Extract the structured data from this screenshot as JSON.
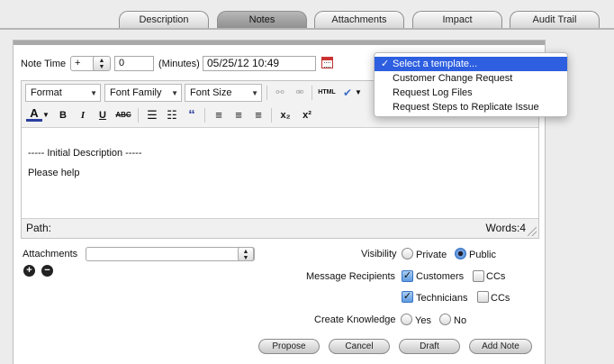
{
  "tabs": [
    {
      "label": "Description",
      "active": false
    },
    {
      "label": "Notes",
      "active": true
    },
    {
      "label": "Attachments",
      "active": false
    },
    {
      "label": "Impact",
      "active": false
    },
    {
      "label": "Audit Trail",
      "active": false
    }
  ],
  "note_time": {
    "label": "Note Time",
    "sign": "+",
    "value": "0",
    "unit_label": "(Minutes)",
    "datetime": "05/25/12 10:49"
  },
  "editor": {
    "format_select": "Format",
    "font_family_select": "Font Family",
    "font_size_select": "Font Size",
    "html_label": "HTML",
    "content_line1": "----- Initial Description -----",
    "content_line2": "Please help",
    "path_label": "Path:",
    "words_label": "Words:4"
  },
  "template_menu": {
    "items": [
      {
        "label": "Select a template...",
        "selected": true,
        "tick": "✓"
      },
      {
        "label": "Customer Change Request",
        "selected": false
      },
      {
        "label": "Request Log Files",
        "selected": false
      },
      {
        "label": "Request Steps to Replicate Issue",
        "selected": false
      }
    ]
  },
  "attachments": {
    "label": "Attachments",
    "value": ""
  },
  "visibility": {
    "label": "Visibility",
    "private": "Private",
    "public": "Public",
    "selected": "Public"
  },
  "recipients": {
    "label": "Message Recipients",
    "customers": "Customers",
    "customers_checked": true,
    "customers_ccs": "CCs",
    "customers_ccs_checked": false,
    "technicians": "Technicians",
    "technicians_checked": true,
    "technicians_ccs": "CCs",
    "technicians_ccs_checked": false
  },
  "knowledge": {
    "label": "Create Knowledge",
    "yes": "Yes",
    "no": "No"
  },
  "buttons": {
    "propose": "Propose",
    "cancel": "Cancel",
    "draft": "Draft",
    "add_note": "Add Note"
  },
  "colors": {
    "menu_highlight": "#2d5fe0",
    "active_tab": "#9c9c9c"
  }
}
